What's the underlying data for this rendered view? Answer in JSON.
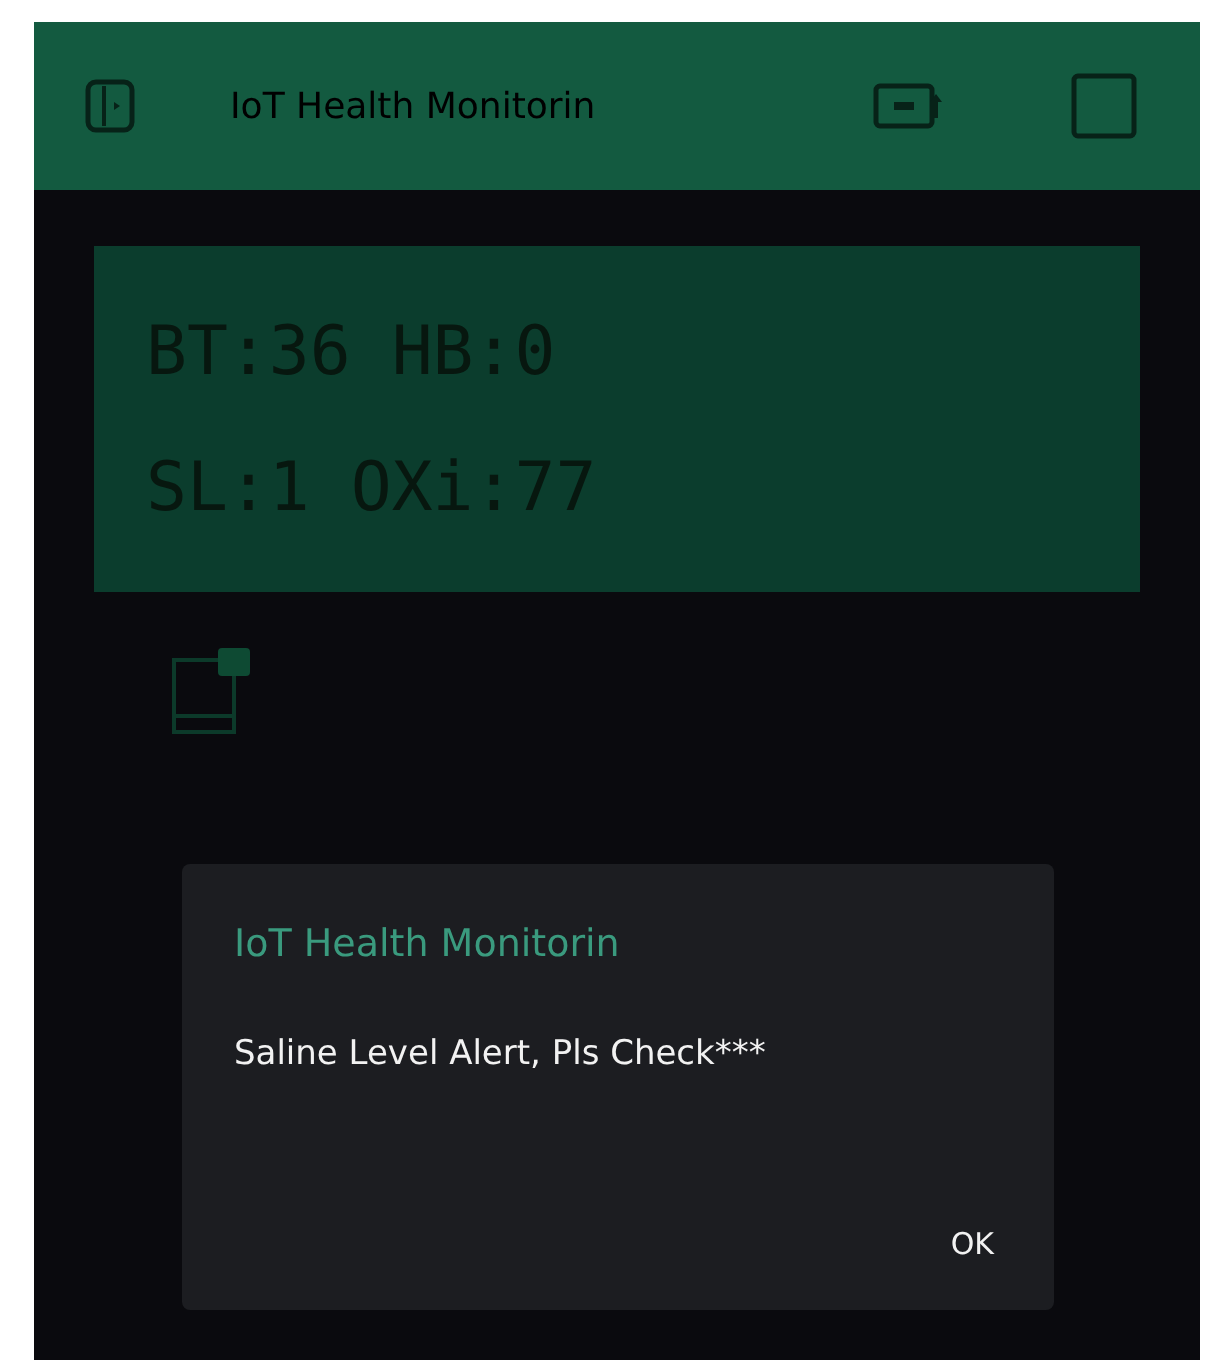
{
  "app_bar": {
    "title": "IoT Health Monitorin"
  },
  "lcd": {
    "lines": [
      "BT:36 HB:0",
      "SL:1 OXi:77"
    ]
  },
  "dialog": {
    "title": "IoT Health Monitorin",
    "message": "Saline Level Alert, Pls Check***",
    "buttons": [
      "OK"
    ]
  }
}
